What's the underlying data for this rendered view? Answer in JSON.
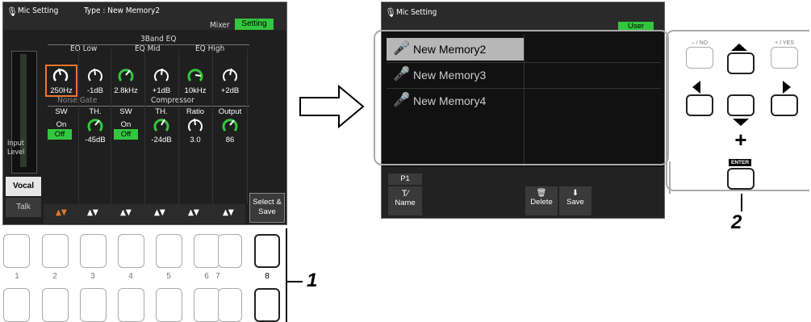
{
  "left": {
    "title": "Mic Setting",
    "type_label": "Type : New Memory2",
    "tabs": [
      "Mixer",
      "Setting"
    ],
    "eq_title": "3Band EQ",
    "eq_groups": [
      "EQ Low",
      "EQ Mid",
      "EQ High"
    ],
    "eq_values": [
      "250Hz",
      "-1dB",
      "2.8kHz",
      "+1dB",
      "10kHz",
      "+2dB"
    ],
    "noise_gate": "Noise Gate",
    "compressor": "Compressor",
    "param_headers": [
      "SW",
      "TH.",
      "SW",
      "TH.",
      "Ratio",
      "Output"
    ],
    "sw_on": [
      "On",
      "On"
    ],
    "sw_off": [
      "Off",
      "Off"
    ],
    "param_values": [
      "-45dB",
      "-24dB",
      "3.0",
      "86"
    ],
    "input_level": "Input\nLevel",
    "side_tabs": [
      "Vocal",
      "Talk"
    ],
    "select_save": "Select &\nSave"
  },
  "buttons_numbers": [
    "1",
    "2",
    "3",
    "4",
    "5",
    "6",
    "7",
    "8"
  ],
  "callout_1": "1",
  "right": {
    "title": "Mic Setting",
    "user_tab": "User",
    "memories": [
      "New Memory2",
      "New Memory3",
      "New Memory4"
    ],
    "page_tab": "P1",
    "bottom": [
      "Name",
      "Delete",
      "Save"
    ]
  },
  "controls": {
    "no_label": "– / NO",
    "yes_label": "+ / YES",
    "enter_label": "ENTER",
    "plus": "+",
    "callout_2": "2"
  },
  "colors": {
    "accent_green": "#33c73f",
    "orange": "#e8772e",
    "highlight_gray": "#b7b7b7"
  }
}
